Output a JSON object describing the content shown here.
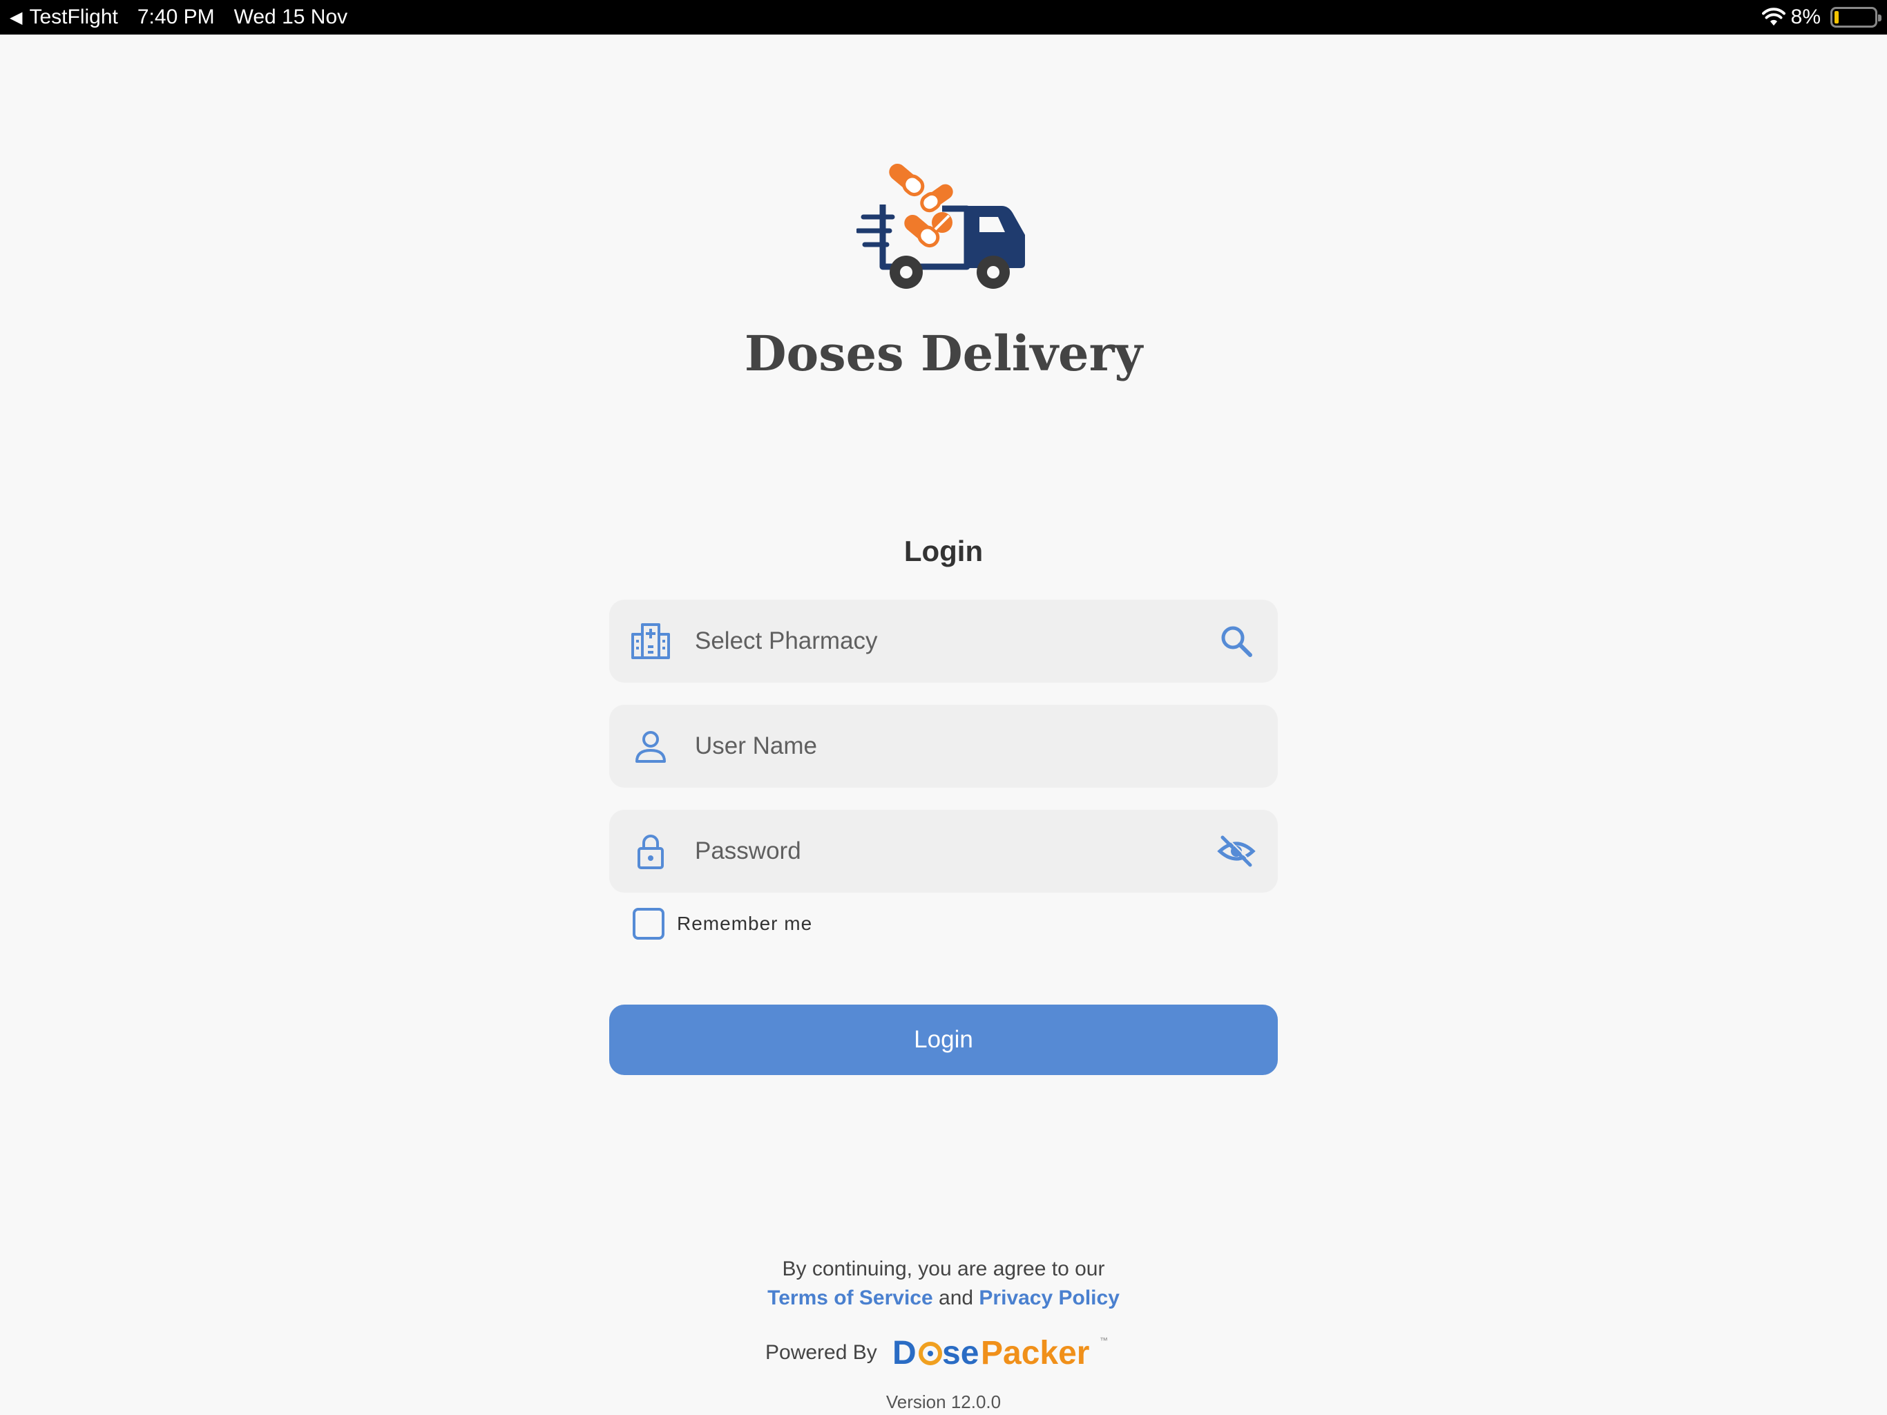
{
  "status_bar": {
    "back_app": "TestFlight",
    "time": "7:40 PM",
    "date": "Wed 15 Nov",
    "battery": "8%",
    "battery_level": 0.08
  },
  "app": {
    "title": "Doses Delivery",
    "logo_icon": "delivery-truck-pills-logo"
  },
  "login": {
    "heading": "Login",
    "pharmacy_placeholder": "Select Pharmacy",
    "username_placeholder": "User Name",
    "password_placeholder": "Password",
    "remember_label": "Remember me",
    "remember_checked": false,
    "button_label": "Login"
  },
  "footer": {
    "agree_text": "By continuing, you are agree to our",
    "terms_link": "Terms of Service",
    "and_text": "and",
    "privacy_link": "Privacy Policy",
    "powered_by": "Powered By",
    "brand": "DosePacker",
    "version": "Version 12.0.0"
  },
  "colors": {
    "accent": "#568ad4",
    "logo_navy": "#1f3b6e",
    "logo_orange": "#f07a2a"
  }
}
